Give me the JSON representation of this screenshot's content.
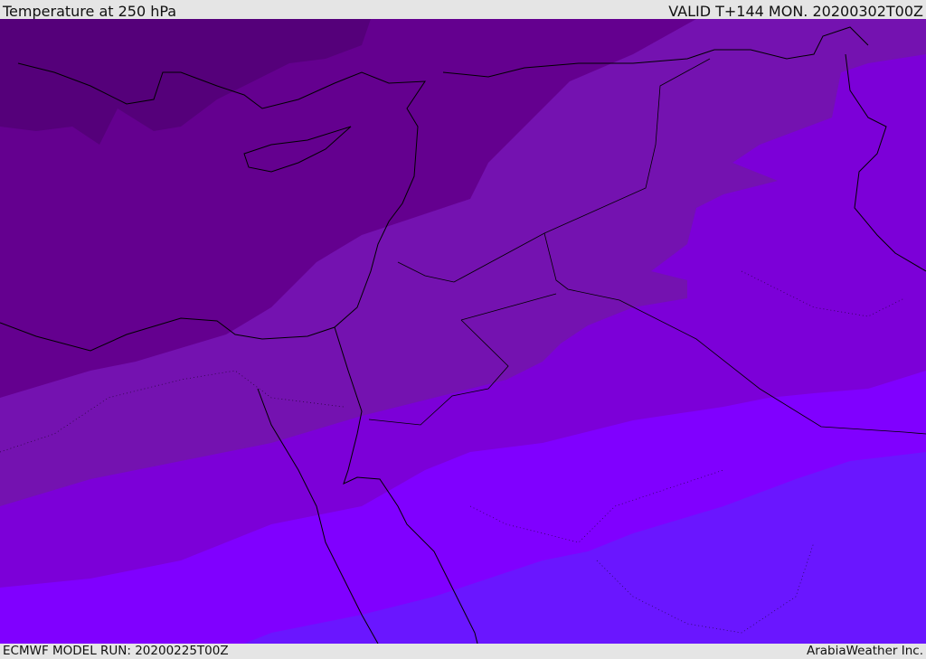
{
  "header": {
    "title": "Temperature at 250 hPa",
    "valid": "VALID T+144 MON. 20200302T00Z"
  },
  "footer": {
    "model_run": "ECMWF MODEL RUN: 20200225T00Z",
    "credit": "ArabiaWeather Inc."
  },
  "map": {
    "variable": "temperature-250hPa",
    "band_colors": [
      "#55007a",
      "#64008f",
      "#7412b0",
      "#7c00d8",
      "#8000ff",
      "#6a16ff"
    ],
    "line_color": "#000000"
  }
}
